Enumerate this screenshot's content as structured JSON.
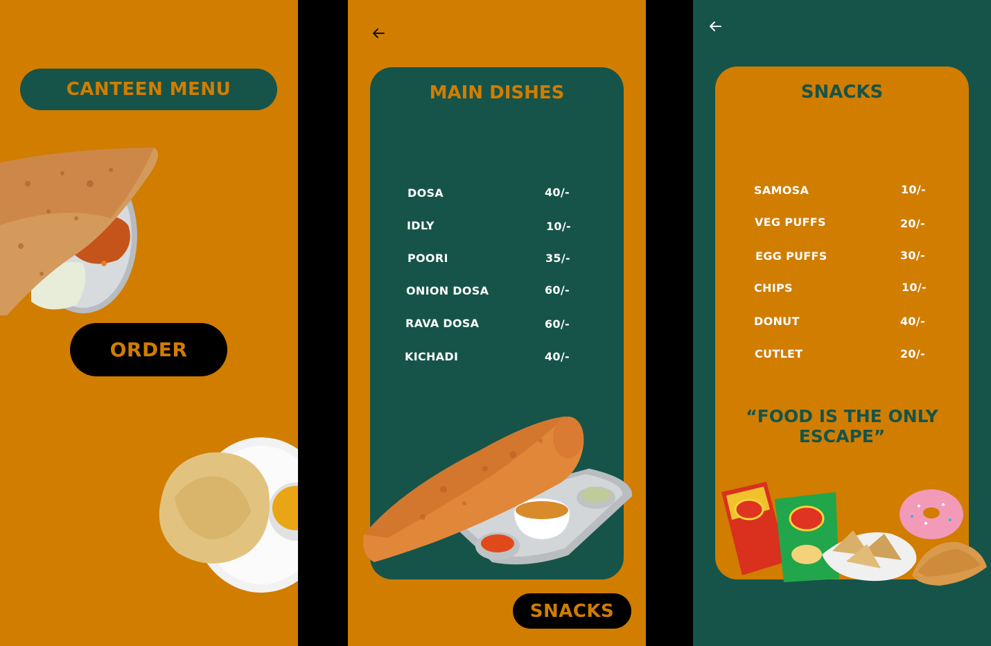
{
  "screen1": {
    "title": "CANTEEN MENU",
    "order_label": "ORDER"
  },
  "screen2": {
    "back_icon": "arrow-left-icon",
    "title": "MAIN DISHES",
    "items": [
      {
        "name": "DOSA",
        "price": "40/-"
      },
      {
        "name": "IDLY",
        "price": "10/-"
      },
      {
        "name": "POORI",
        "price": "35/-"
      },
      {
        "name": "ONION DOSA",
        "price": "60/-"
      },
      {
        "name": "RAVA DOSA",
        "price": "60/-"
      },
      {
        "name": "KICHADI",
        "price": "40/-"
      }
    ],
    "next_label": "SNACKS"
  },
  "screen3": {
    "back_icon": "arrow-left-icon",
    "title": "SNACKS",
    "items": [
      {
        "name": "SAMOSA",
        "price": "10/-"
      },
      {
        "name": "VEG PUFFS",
        "price": "20/-"
      },
      {
        "name": "EGG PUFFS",
        "price": "30/-"
      },
      {
        "name": "CHIPS",
        "price": "10/-"
      },
      {
        "name": "DONUT",
        "price": "40/-"
      },
      {
        "name": "CUTLET",
        "price": "20/-"
      }
    ],
    "quote": "“FOOD IS THE ONLY ESCAPE”"
  },
  "colors": {
    "orange": "#D17D00",
    "green": "#16544A",
    "black": "#000000",
    "white": "#FFFFFF"
  }
}
